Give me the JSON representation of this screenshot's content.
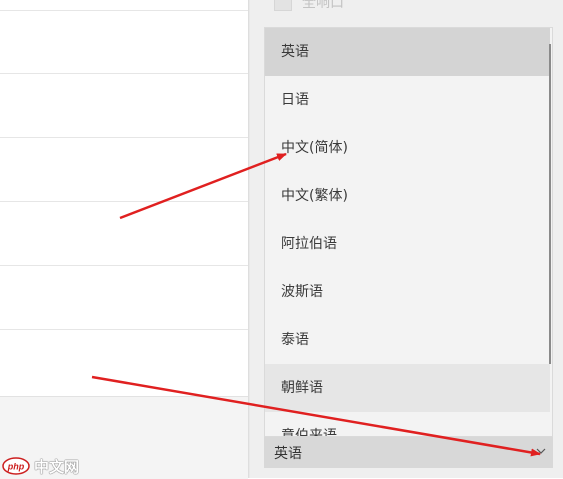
{
  "panel": {
    "top_option_label": "全响口"
  },
  "dropdown": {
    "options": [
      {
        "label": "英语",
        "state": "selected"
      },
      {
        "label": "日语",
        "state": "normal"
      },
      {
        "label": "中文(简体)",
        "state": "normal"
      },
      {
        "label": "中文(繁体)",
        "state": "normal"
      },
      {
        "label": "阿拉伯语",
        "state": "normal"
      },
      {
        "label": "波斯语",
        "state": "normal"
      },
      {
        "label": "泰语",
        "state": "normal"
      },
      {
        "label": "朝鲜语",
        "state": "hover"
      },
      {
        "label": "意伯来语",
        "state": "normal"
      }
    ]
  },
  "select": {
    "value": "英语",
    "icon": "chevron-down-icon"
  },
  "annotations": {
    "arrow_color": "#e02020"
  },
  "watermark": {
    "logo_text": "php",
    "text": "中文网"
  }
}
